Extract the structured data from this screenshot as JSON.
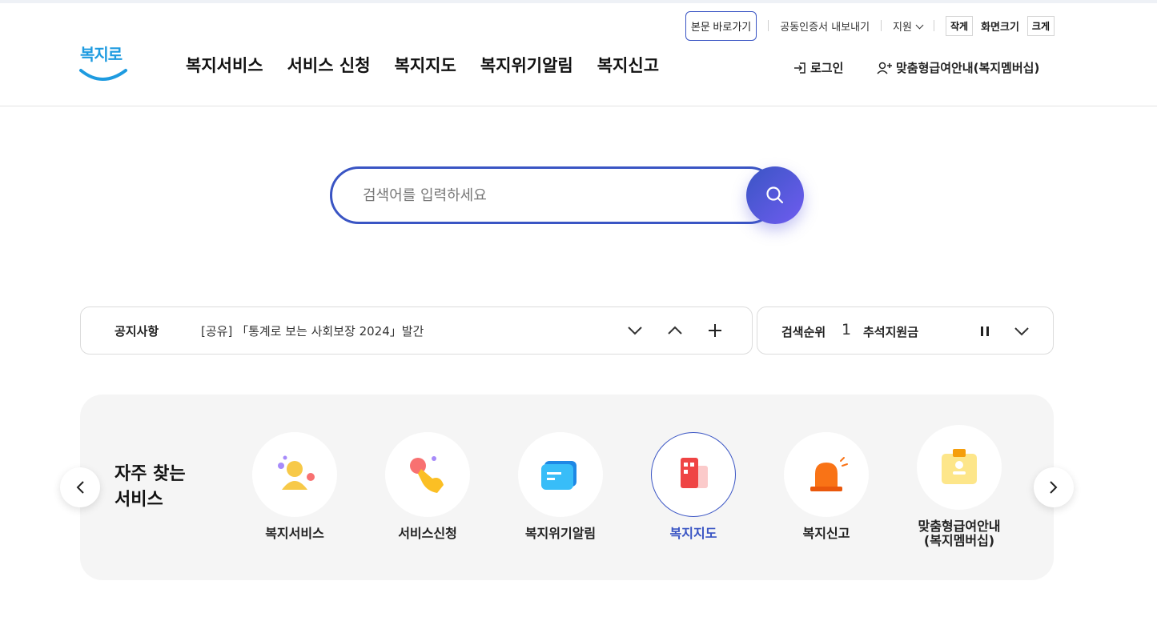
{
  "header": {
    "logo_text": "복지로",
    "skip_label": "본문 바로가기",
    "cert_label": "공동인증서 내보내기",
    "support_label": "지원",
    "font_small": "작게",
    "font_size_label": "화면크기",
    "font_large": "크게",
    "nav": [
      "복지서비스",
      "서비스 신청",
      "복지지도",
      "복지위기알림",
      "복지신고"
    ],
    "login_label": "로그인",
    "member_label": "맞춤형급여안내(복지멤버십)"
  },
  "search": {
    "placeholder": "검색어를 입력하세요"
  },
  "notice": {
    "label": "공지사항",
    "text": "[공유] 「통계로 보는 사회보장 2024」발간"
  },
  "rank": {
    "label": "검색순위",
    "number": "1",
    "keyword": "추석지원금"
  },
  "quick": {
    "title_line1": "자주 찾는",
    "title_line2": "서비스",
    "items": [
      {
        "label": "복지서비스",
        "icon": "person-icon"
      },
      {
        "label": "서비스신청",
        "icon": "hand-pointer-icon"
      },
      {
        "label": "복지위기알림",
        "icon": "message-icon"
      },
      {
        "label": "복지지도",
        "icon": "building-map-icon"
      },
      {
        "label": "복지신고",
        "icon": "siren-icon"
      },
      {
        "label": "맞춤형급여안내",
        "label2": "(복지멤버십)",
        "icon": "id-badge-icon"
      }
    ],
    "active_index": 3
  },
  "colors": {
    "accent": "#3a55c4",
    "logo": "#1e9be0"
  }
}
